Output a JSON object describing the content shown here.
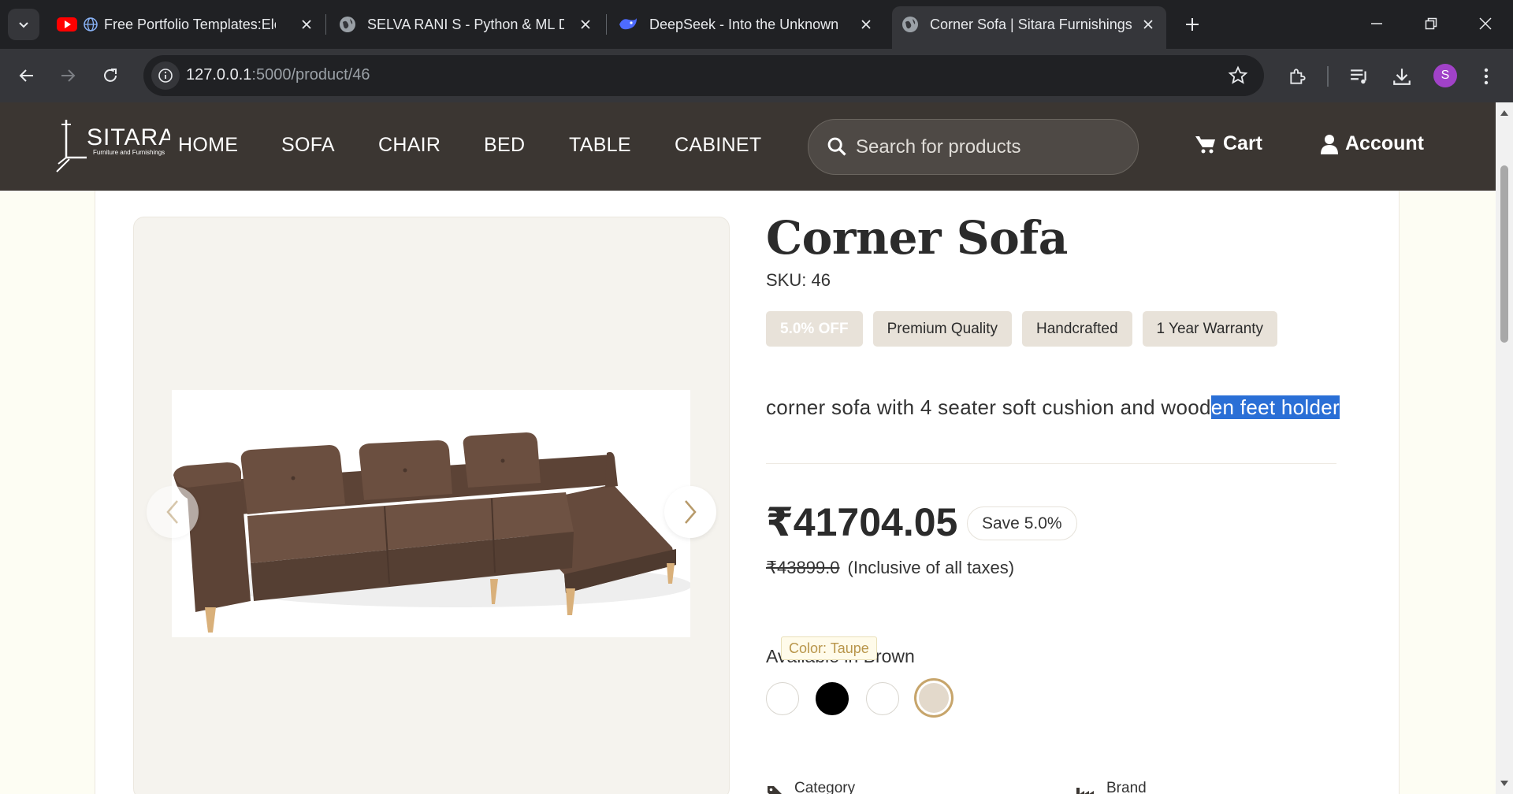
{
  "browser": {
    "tabs": [
      {
        "title": "Free Portfolio Templates:Ele",
        "icon": "youtube-icon"
      },
      {
        "title": "SELVA RANI S - Python & ML D",
        "icon": "globe-icon"
      },
      {
        "title": "DeepSeek - Into the Unknown",
        "icon": "deepseek-icon"
      },
      {
        "title": "Corner Sofa | Sitara Furnishings",
        "icon": "globe-icon",
        "active": true
      }
    ],
    "url_host": "127.0.0.1",
    "url_path": ":5000/product/46",
    "profile_initial": "S",
    "profile_color": "#a142c8"
  },
  "site": {
    "logo_text": "SITARA",
    "logo_tagline": "Furniture and Furnishings",
    "nav": [
      "HOME",
      "SOFA",
      "CHAIR",
      "BED",
      "TABLE",
      "CABINET"
    ],
    "search_placeholder": "Search for products",
    "cart_label": "Cart",
    "account_label": "Account",
    "header_color": "#3b3632"
  },
  "product": {
    "title": "Corner Sofa",
    "sku": "SKU: 46",
    "badges": [
      "5.0% OFF",
      "Premium Quality",
      "Handcrafted",
      "1 Year Warranty"
    ],
    "description_plain": "corner sofa with 4 seater soft cushion and wood",
    "description_selected": "en feet holder",
    "price": "₹41704.05",
    "save": "Save 5.0%",
    "mrp": "₹43899.0",
    "tax_note": "(Inclusive of all taxes)",
    "availability": "Available in Brown",
    "color_tooltip": "Color: Taupe",
    "swatches": [
      {
        "name": "white",
        "color": "#ffffff"
      },
      {
        "name": "black",
        "color": "#000000"
      },
      {
        "name": "white",
        "color": "#ffffff"
      },
      {
        "name": "taupe",
        "color": "#e3d9cb",
        "selected": true
      }
    ],
    "meta": [
      {
        "label": "Category",
        "icon": "tag-icon"
      },
      {
        "label": "Brand",
        "icon": "industry-icon"
      }
    ]
  }
}
